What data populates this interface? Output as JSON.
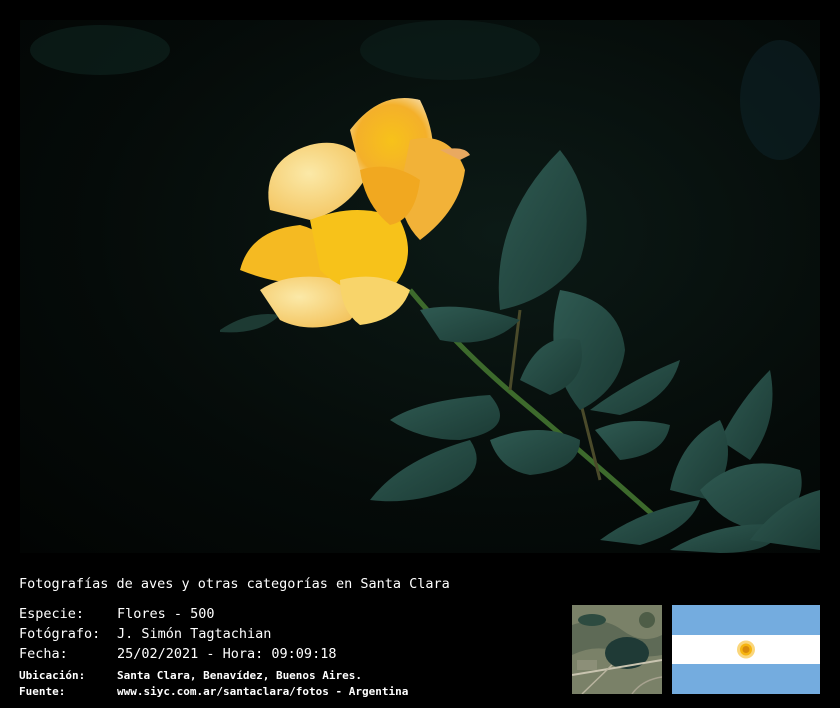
{
  "caption": {
    "title": "Fotografías de aves y otras categorías en Santa Clara",
    "species": {
      "label": "Especie:",
      "value": "Flores - 500"
    },
    "photographer": {
      "label": "Fotógrafo:",
      "value": "J. Simón Tagtachian"
    },
    "date": {
      "label": "Fecha:",
      "value": "25/02/2021 - Hora: 09:09:18"
    },
    "location": {
      "label": "Ubicación:",
      "value": "Santa Clara, Benavídez, Buenos Aires."
    },
    "source": {
      "label": "Fuente:",
      "value": "www.siyc.com.ar/santaclara/fotos - Argentina"
    }
  },
  "photo": {
    "subject": "yellow-rose-icon"
  },
  "colors": {
    "background": "#000000",
    "flag_blue": "#74acdf",
    "flag_white": "#ffffff",
    "sun": "#f6b40e"
  }
}
